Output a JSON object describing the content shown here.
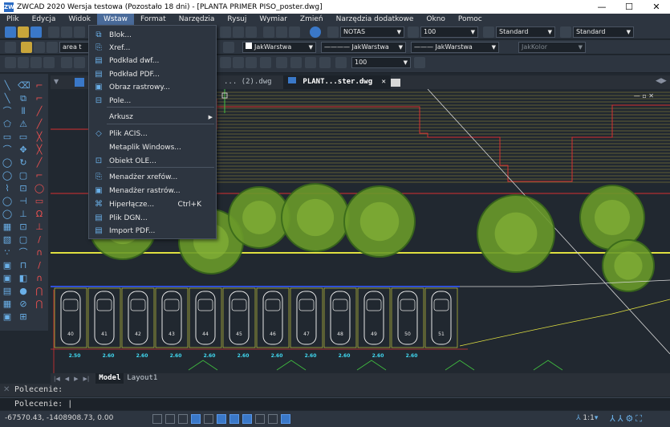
{
  "window": {
    "app_icon": "ZW",
    "title": "ZWCAD 2020 Wersja testowa (Pozostało 18 dni) - [PLANTA PRIMER PISO_poster.dwg]",
    "minimize": "—",
    "maximize": "☐",
    "close": "✕"
  },
  "menu": [
    "Plik",
    "Edycja",
    "Widok",
    "Wstaw",
    "Format",
    "Narzędzia",
    "Rysuj",
    "Wymiar",
    "Zmień",
    "Narzędzia dodatkowe",
    "Okno",
    "Pomoc"
  ],
  "active_menu": "Wstaw",
  "toolbars": {
    "textstyle": "NOTAS",
    "text_height": "100",
    "dimstyle": "Standard",
    "tablestyle": "Standard",
    "layer_text": "area t",
    "color": "JakWarstwa",
    "linetype": "JakWarstwa",
    "lineweight": "JakWarstwa",
    "plotstyle": "JakKolor",
    "scale_value": "100"
  },
  "insert_menu": [
    {
      "label": "Blok...",
      "icon": "block-icon"
    },
    {
      "label": "Xref...",
      "icon": "xref-icon"
    },
    {
      "label": "Podkład dwf...",
      "icon": "dwf-icon"
    },
    {
      "label": "Podkład PDF...",
      "icon": "pdf-underlay-icon"
    },
    {
      "label": "Obraz rastrowy...",
      "icon": "raster-image-icon"
    },
    {
      "label": "Pole...",
      "icon": "field-icon"
    },
    {
      "label": "Arkusz",
      "icon": "",
      "submenu": true
    },
    {
      "label": "Plik ACIS...",
      "icon": "acis-icon"
    },
    {
      "label": "Metaplik Windows...",
      "icon": ""
    },
    {
      "label": "Obiekt OLE...",
      "icon": "ole-icon"
    },
    {
      "label": "Menadżer xrefów...",
      "icon": "xref-manager-icon"
    },
    {
      "label": "Menadżer rastrów...",
      "icon": "raster-manager-icon"
    },
    {
      "label": "Hiperłącze...",
      "icon": "hyperlink-icon",
      "shortcut": "Ctrl+K"
    },
    {
      "label": "Plik DGN...",
      "icon": "dgn-icon"
    },
    {
      "label": "Import PDF...",
      "icon": "pdf-import-icon"
    }
  ],
  "doc_tabs": [
    {
      "label": "... (2).dwg",
      "active": false
    },
    {
      "label": "PLANT...ster.dwg",
      "active": true,
      "close": "✕"
    }
  ],
  "layout_tabs": [
    "Model",
    "Layout1"
  ],
  "command_lines": [
    "Polecenie:",
    "Polecenie:"
  ],
  "coordinates": "-67570.43, -1408908.73, 0.00",
  "scale": "1:1",
  "dimensions": [
    "2.50",
    "2.60",
    "2.60",
    "2.60",
    "2.60",
    "2.60",
    "2.60",
    "2.60",
    "2.60",
    "2.60",
    "2.60"
  ],
  "stall_numbers": [
    "40",
    "41",
    "42",
    "43",
    "44",
    "45",
    "46",
    "47",
    "48",
    "49",
    "50",
    "51"
  ],
  "colors": {
    "background": "#212830",
    "menu_highlight": "#4a6b9a",
    "tree_green": "#6a9a2a",
    "hatch_yellow": "#c8b040",
    "line_red": "#d83030",
    "parking_blue": "#3050d8"
  }
}
